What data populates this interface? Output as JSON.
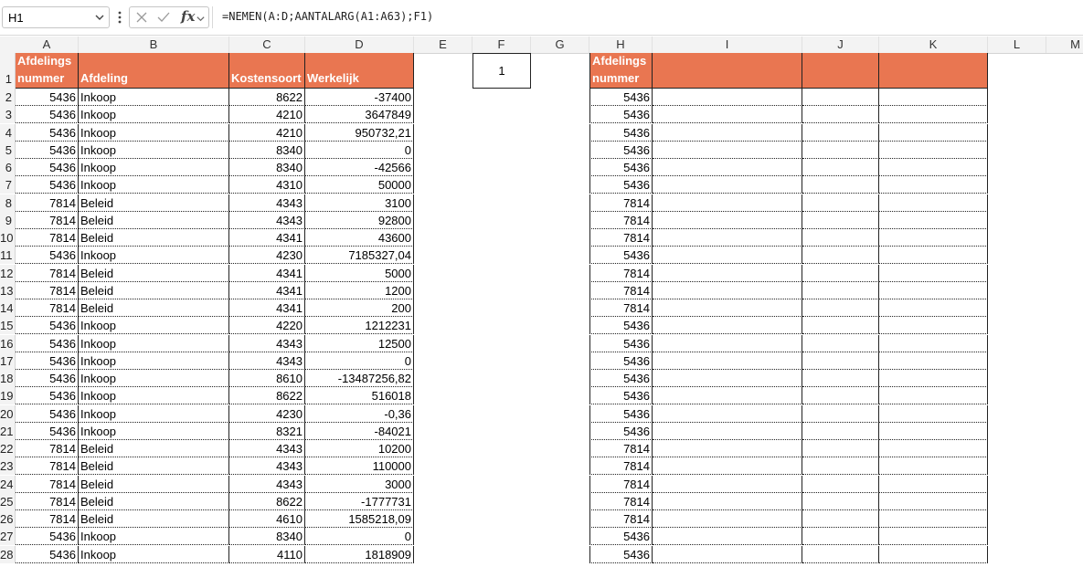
{
  "formula_bar": {
    "name_box": "H1",
    "fx_label": "fx",
    "formula": "=NEMEN(A:D;AANTALARG(A1:A63);F1)"
  },
  "columns": [
    "A",
    "B",
    "C",
    "D",
    "E",
    "F",
    "G",
    "H",
    "I",
    "J",
    "K",
    "L",
    "M"
  ],
  "headers": {
    "A1_line1": "Afdelings",
    "A1_line2": "nummer",
    "B1": "Afdeling",
    "C1": "Kostensoort",
    "D1": "Werkelijk",
    "F1": "1",
    "H1_line1": "Afdelings",
    "H1_line2": "nummer"
  },
  "rows": [
    {
      "n": "2",
      "a": "5436",
      "b": "Inkoop",
      "c": "8622",
      "d": "-37400",
      "h": "5436"
    },
    {
      "n": "3",
      "a": "5436",
      "b": "Inkoop",
      "c": "4210",
      "d": "3647849",
      "h": "5436"
    },
    {
      "n": "4",
      "a": "5436",
      "b": "Inkoop",
      "c": "4210",
      "d": "950732,21",
      "h": "5436"
    },
    {
      "n": "5",
      "a": "5436",
      "b": "Inkoop",
      "c": "8340",
      "d": "0",
      "h": "5436"
    },
    {
      "n": "6",
      "a": "5436",
      "b": "Inkoop",
      "c": "8340",
      "d": "-42566",
      "h": "5436"
    },
    {
      "n": "7",
      "a": "5436",
      "b": "Inkoop",
      "c": "4310",
      "d": "50000",
      "h": "5436"
    },
    {
      "n": "8",
      "a": "7814",
      "b": "Beleid",
      "c": "4343",
      "d": "3100",
      "h": "7814"
    },
    {
      "n": "9",
      "a": "7814",
      "b": "Beleid",
      "c": "4343",
      "d": "92800",
      "h": "7814"
    },
    {
      "n": "10",
      "a": "7814",
      "b": "Beleid",
      "c": "4341",
      "d": "43600",
      "h": "7814"
    },
    {
      "n": "11",
      "a": "5436",
      "b": "Inkoop",
      "c": "4230",
      "d": "7185327,04",
      "h": "5436"
    },
    {
      "n": "12",
      "a": "7814",
      "b": "Beleid",
      "c": "4341",
      "d": "5000",
      "h": "7814"
    },
    {
      "n": "13",
      "a": "7814",
      "b": "Beleid",
      "c": "4341",
      "d": "1200",
      "h": "7814"
    },
    {
      "n": "14",
      "a": "7814",
      "b": "Beleid",
      "c": "4341",
      "d": "200",
      "h": "7814"
    },
    {
      "n": "15",
      "a": "5436",
      "b": "Inkoop",
      "c": "4220",
      "d": "1212231",
      "h": "5436"
    },
    {
      "n": "16",
      "a": "5436",
      "b": "Inkoop",
      "c": "4343",
      "d": "12500",
      "h": "5436"
    },
    {
      "n": "17",
      "a": "5436",
      "b": "Inkoop",
      "c": "4343",
      "d": "0",
      "h": "5436"
    },
    {
      "n": "18",
      "a": "5436",
      "b": "Inkoop",
      "c": "8610",
      "d": "-13487256,82",
      "h": "5436"
    },
    {
      "n": "19",
      "a": "5436",
      "b": "Inkoop",
      "c": "8622",
      "d": "516018",
      "h": "5436"
    },
    {
      "n": "20",
      "a": "5436",
      "b": "Inkoop",
      "c": "4230",
      "d": "-0,36",
      "h": "5436"
    },
    {
      "n": "21",
      "a": "5436",
      "b": "Inkoop",
      "c": "8321",
      "d": "-84021",
      "h": "5436"
    },
    {
      "n": "22",
      "a": "7814",
      "b": "Beleid",
      "c": "4343",
      "d": "10200",
      "h": "7814"
    },
    {
      "n": "23",
      "a": "7814",
      "b": "Beleid",
      "c": "4343",
      "d": "110000",
      "h": "7814"
    },
    {
      "n": "24",
      "a": "7814",
      "b": "Beleid",
      "c": "4343",
      "d": "3000",
      "h": "7814"
    },
    {
      "n": "25",
      "a": "7814",
      "b": "Beleid",
      "c": "8622",
      "d": "-1777731",
      "h": "7814"
    },
    {
      "n": "26",
      "a": "7814",
      "b": "Beleid",
      "c": "4610",
      "d": "1585218,09",
      "h": "7814"
    },
    {
      "n": "27",
      "a": "5436",
      "b": "Inkoop",
      "c": "8340",
      "d": "0",
      "h": "5436"
    },
    {
      "n": "28",
      "a": "5436",
      "b": "Inkoop",
      "c": "4110",
      "d": "1818909",
      "h": "5436"
    }
  ],
  "colors": {
    "header_fill": "#e97651",
    "header_text": "#ffffff"
  },
  "icons": {
    "name_box_dropdown": "chevron-down-icon",
    "kebab": "more-vertical-icon",
    "cancel": "close-icon",
    "confirm": "check-icon",
    "fx_dropdown": "chevron-down-icon",
    "pointer": "mouse-pointer-icon"
  }
}
